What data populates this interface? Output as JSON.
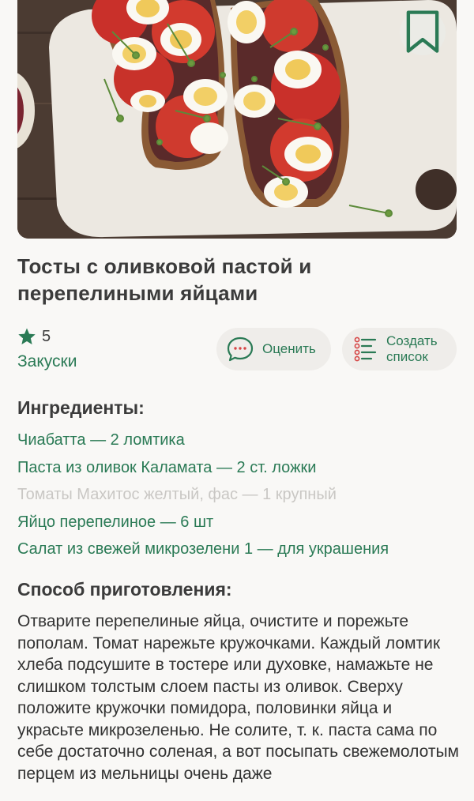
{
  "recipe": {
    "title": "Тосты с оливковой пастой и перепелиными яйцами",
    "rating": "5",
    "category": "Закуски"
  },
  "actions": {
    "rate_label": "Оценить",
    "create_list_label": "Создать\nсписок"
  },
  "ingredients": {
    "heading": "Ингредиенты:",
    "items": [
      {
        "text": "Чиабатта — 2 ломтика",
        "available": true
      },
      {
        "text": "Паста из оливок Каламата — 2 ст. ложки",
        "available": true
      },
      {
        "text": "Томаты Махитос желтый, фас — 1 крупный",
        "available": false
      },
      {
        "text": "Яйцо перепелиное — 6 шт",
        "available": true
      },
      {
        "text": "Салат из свежей микрозелени 1 — для украшения",
        "available": true
      }
    ]
  },
  "method": {
    "heading": "Способ приготовления:",
    "text": "Отварите перепелиные яйца, очистите и порежьте пополам. Томат нарежьте кружочками. Каждый ломтик хлеба подсушите в тостере или духовке, намажьте не слишком толстым слоем пасты из оливок. Сверху положите кружочки помидора, половинки яйца и украсьте микрозеленью. Не солите, т. к. паста сама по себе достаточно соленая, а вот посыпать свежемолотым перцем из мельницы очень даже"
  },
  "colors": {
    "accent": "#2a7a55",
    "muted": "#c9c7c4",
    "background": "#f9f8f6"
  },
  "icons": {
    "bookmark": "bookmark-icon",
    "star": "star-icon",
    "rate": "chat-bubble-icon",
    "list": "checklist-icon"
  }
}
